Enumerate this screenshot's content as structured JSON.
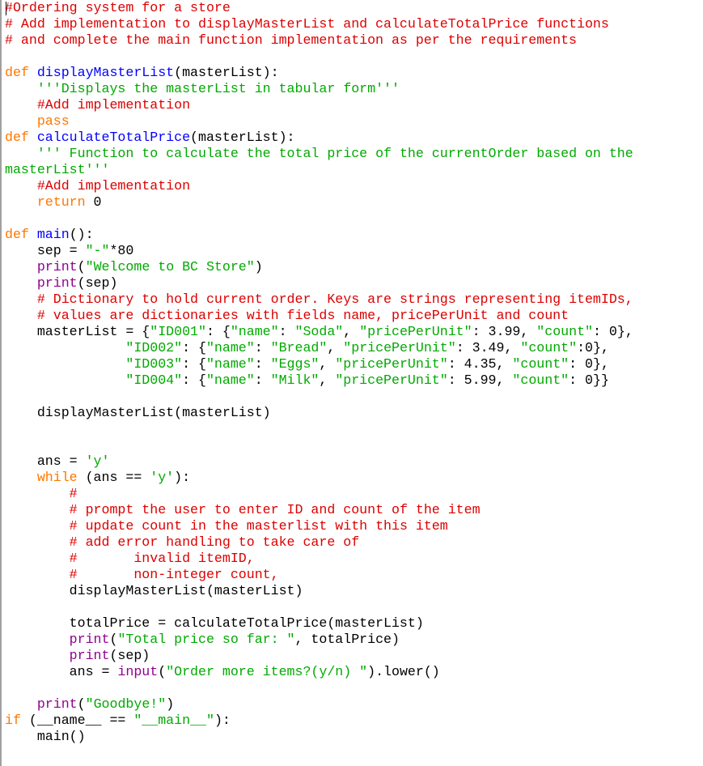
{
  "editor": {
    "language": "python",
    "colors": {
      "comment": "#dd0000",
      "keyword": "#ff7700",
      "definition": "#0000ff",
      "string": "#00aa00",
      "builtin": "#900090",
      "plain": "#000000"
    },
    "lines": [
      [
        {
          "t": "comment",
          "v": "#Ordering system for a store"
        }
      ],
      [
        {
          "t": "comment",
          "v": "# Add implementation to displayMasterList and calculateTotalPrice functions"
        }
      ],
      [
        {
          "t": "comment",
          "v": "# and complete the main function implementation as per the requirements"
        }
      ],
      [],
      [
        {
          "t": "kw",
          "v": "def "
        },
        {
          "t": "def",
          "v": "displayMasterList"
        },
        {
          "t": "plain",
          "v": "(masterList):"
        }
      ],
      [
        {
          "t": "plain",
          "v": "    "
        },
        {
          "t": "str",
          "v": "'''Displays the masterList in tabular form'''"
        }
      ],
      [
        {
          "t": "plain",
          "v": "    "
        },
        {
          "t": "comment",
          "v": "#Add implementation"
        }
      ],
      [
        {
          "t": "plain",
          "v": "    "
        },
        {
          "t": "kw",
          "v": "pass"
        }
      ],
      [
        {
          "t": "kw",
          "v": "def "
        },
        {
          "t": "def",
          "v": "calculateTotalPrice"
        },
        {
          "t": "plain",
          "v": "(masterList):"
        }
      ],
      [
        {
          "t": "plain",
          "v": "    "
        },
        {
          "t": "str",
          "v": "''' Function to calculate the total price of the currentOrder based on the"
        }
      ],
      [
        {
          "t": "str",
          "v": "masterList'''"
        }
      ],
      [
        {
          "t": "plain",
          "v": "    "
        },
        {
          "t": "comment",
          "v": "#Add implementation"
        }
      ],
      [
        {
          "t": "plain",
          "v": "    "
        },
        {
          "t": "kw",
          "v": "return"
        },
        {
          "t": "plain",
          "v": " 0"
        }
      ],
      [],
      [
        {
          "t": "kw",
          "v": "def "
        },
        {
          "t": "def",
          "v": "main"
        },
        {
          "t": "plain",
          "v": "():"
        }
      ],
      [
        {
          "t": "plain",
          "v": "    sep = "
        },
        {
          "t": "str",
          "v": "\"-\""
        },
        {
          "t": "plain",
          "v": "*80"
        }
      ],
      [
        {
          "t": "plain",
          "v": "    "
        },
        {
          "t": "builtin",
          "v": "print"
        },
        {
          "t": "plain",
          "v": "("
        },
        {
          "t": "str",
          "v": "\"Welcome to BC Store\""
        },
        {
          "t": "plain",
          "v": ")"
        }
      ],
      [
        {
          "t": "plain",
          "v": "    "
        },
        {
          "t": "builtin",
          "v": "print"
        },
        {
          "t": "plain",
          "v": "(sep)"
        }
      ],
      [
        {
          "t": "plain",
          "v": "    "
        },
        {
          "t": "comment",
          "v": "# Dictionary to hold current order. Keys are strings representing itemIDs,"
        }
      ],
      [
        {
          "t": "plain",
          "v": "    "
        },
        {
          "t": "comment",
          "v": "# values are dictionaries with fields name, pricePerUnit and count"
        }
      ],
      [
        {
          "t": "plain",
          "v": "    masterList = {"
        },
        {
          "t": "str",
          "v": "\"ID001\""
        },
        {
          "t": "plain",
          "v": ": {"
        },
        {
          "t": "str",
          "v": "\"name\""
        },
        {
          "t": "plain",
          "v": ": "
        },
        {
          "t": "str",
          "v": "\"Soda\""
        },
        {
          "t": "plain",
          "v": ", "
        },
        {
          "t": "str",
          "v": "\"pricePerUnit\""
        },
        {
          "t": "plain",
          "v": ": 3.99, "
        },
        {
          "t": "str",
          "v": "\"count\""
        },
        {
          "t": "plain",
          "v": ": 0},"
        }
      ],
      [
        {
          "t": "plain",
          "v": "               "
        },
        {
          "t": "str",
          "v": "\"ID002\""
        },
        {
          "t": "plain",
          "v": ": {"
        },
        {
          "t": "str",
          "v": "\"name\""
        },
        {
          "t": "plain",
          "v": ": "
        },
        {
          "t": "str",
          "v": "\"Bread\""
        },
        {
          "t": "plain",
          "v": ", "
        },
        {
          "t": "str",
          "v": "\"pricePerUnit\""
        },
        {
          "t": "plain",
          "v": ": 3.49, "
        },
        {
          "t": "str",
          "v": "\"count\""
        },
        {
          "t": "plain",
          "v": ":0},"
        }
      ],
      [
        {
          "t": "plain",
          "v": "               "
        },
        {
          "t": "str",
          "v": "\"ID003\""
        },
        {
          "t": "plain",
          "v": ": {"
        },
        {
          "t": "str",
          "v": "\"name\""
        },
        {
          "t": "plain",
          "v": ": "
        },
        {
          "t": "str",
          "v": "\"Eggs\""
        },
        {
          "t": "plain",
          "v": ", "
        },
        {
          "t": "str",
          "v": "\"pricePerUnit\""
        },
        {
          "t": "plain",
          "v": ": 4.35, "
        },
        {
          "t": "str",
          "v": "\"count\""
        },
        {
          "t": "plain",
          "v": ": 0},"
        }
      ],
      [
        {
          "t": "plain",
          "v": "               "
        },
        {
          "t": "str",
          "v": "\"ID004\""
        },
        {
          "t": "plain",
          "v": ": {"
        },
        {
          "t": "str",
          "v": "\"name\""
        },
        {
          "t": "plain",
          "v": ": "
        },
        {
          "t": "str",
          "v": "\"Milk\""
        },
        {
          "t": "plain",
          "v": ", "
        },
        {
          "t": "str",
          "v": "\"pricePerUnit\""
        },
        {
          "t": "plain",
          "v": ": 5.99, "
        },
        {
          "t": "str",
          "v": "\"count\""
        },
        {
          "t": "plain",
          "v": ": 0}}"
        }
      ],
      [],
      [
        {
          "t": "plain",
          "v": "    displayMasterList(masterList)"
        }
      ],
      [],
      [],
      [
        {
          "t": "plain",
          "v": "    ans = "
        },
        {
          "t": "str",
          "v": "'y'"
        }
      ],
      [
        {
          "t": "plain",
          "v": "    "
        },
        {
          "t": "kw",
          "v": "while"
        },
        {
          "t": "plain",
          "v": " (ans == "
        },
        {
          "t": "str",
          "v": "'y'"
        },
        {
          "t": "plain",
          "v": "):"
        }
      ],
      [
        {
          "t": "plain",
          "v": "        "
        },
        {
          "t": "comment",
          "v": "#"
        }
      ],
      [
        {
          "t": "plain",
          "v": "        "
        },
        {
          "t": "comment",
          "v": "# prompt the user to enter ID and count of the item"
        }
      ],
      [
        {
          "t": "plain",
          "v": "        "
        },
        {
          "t": "comment",
          "v": "# update count in the masterlist with this item"
        }
      ],
      [
        {
          "t": "plain",
          "v": "        "
        },
        {
          "t": "comment",
          "v": "# add error handling to take care of"
        }
      ],
      [
        {
          "t": "plain",
          "v": "        "
        },
        {
          "t": "comment",
          "v": "#       invalid itemID,"
        }
      ],
      [
        {
          "t": "plain",
          "v": "        "
        },
        {
          "t": "comment",
          "v": "#       non-integer count,"
        }
      ],
      [
        {
          "t": "plain",
          "v": "        displayMasterList(masterList)"
        }
      ],
      [],
      [
        {
          "t": "plain",
          "v": "        totalPrice = calculateTotalPrice(masterList)"
        }
      ],
      [
        {
          "t": "plain",
          "v": "        "
        },
        {
          "t": "builtin",
          "v": "print"
        },
        {
          "t": "plain",
          "v": "("
        },
        {
          "t": "str",
          "v": "\"Total price so far: \""
        },
        {
          "t": "plain",
          "v": ", totalPrice)"
        }
      ],
      [
        {
          "t": "plain",
          "v": "        "
        },
        {
          "t": "builtin",
          "v": "print"
        },
        {
          "t": "plain",
          "v": "(sep)"
        }
      ],
      [
        {
          "t": "plain",
          "v": "        ans = "
        },
        {
          "t": "builtin",
          "v": "input"
        },
        {
          "t": "plain",
          "v": "("
        },
        {
          "t": "str",
          "v": "\"Order more items?(y/n) \""
        },
        {
          "t": "plain",
          "v": ").lower()"
        }
      ],
      [],
      [
        {
          "t": "plain",
          "v": "    "
        },
        {
          "t": "builtin",
          "v": "print"
        },
        {
          "t": "plain",
          "v": "("
        },
        {
          "t": "str",
          "v": "\"Goodbye!\""
        },
        {
          "t": "plain",
          "v": ")"
        }
      ],
      [
        {
          "t": "kw",
          "v": "if"
        },
        {
          "t": "plain",
          "v": " (__name__ == "
        },
        {
          "t": "str",
          "v": "\"__main__\""
        },
        {
          "t": "plain",
          "v": "):"
        }
      ],
      [
        {
          "t": "plain",
          "v": "    main()"
        }
      ]
    ]
  }
}
